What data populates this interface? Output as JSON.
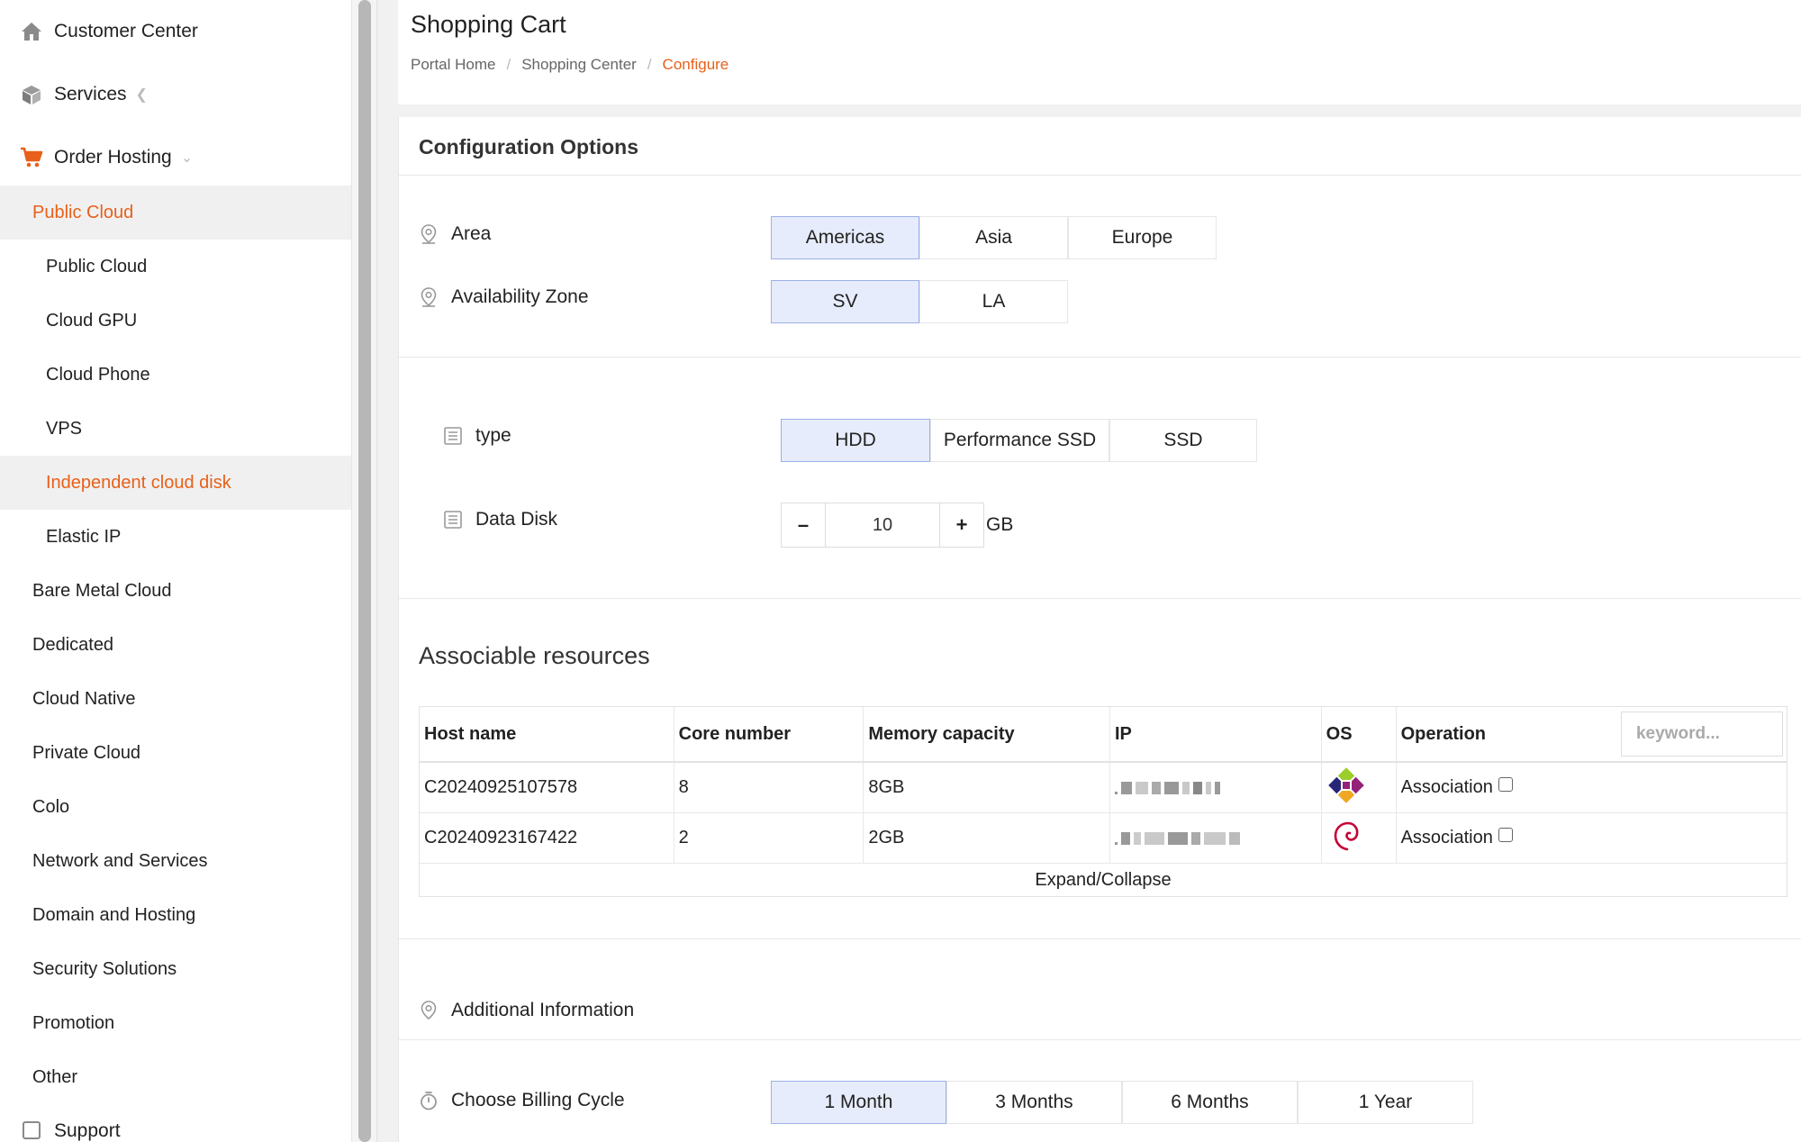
{
  "sidebar": {
    "customer_center": "Customer Center",
    "services": "Services",
    "order_hosting": "Order Hosting",
    "items": [
      {
        "label": "Public Cloud",
        "level": 1,
        "active": true
      },
      {
        "label": "Public Cloud",
        "level": 2,
        "active": false
      },
      {
        "label": "Cloud GPU",
        "level": 2,
        "active": false
      },
      {
        "label": "Cloud Phone",
        "level": 2,
        "active": false
      },
      {
        "label": "VPS",
        "level": 2,
        "active": false
      },
      {
        "label": "Independent cloud disk",
        "level": 2,
        "active": true
      },
      {
        "label": "Elastic IP",
        "level": 2,
        "active": false
      },
      {
        "label": "Bare Metal Cloud",
        "level": 1,
        "active": false
      },
      {
        "label": "Dedicated",
        "level": 1,
        "active": false
      },
      {
        "label": "Cloud Native",
        "level": 1,
        "active": false
      },
      {
        "label": "Private Cloud",
        "level": 1,
        "active": false
      },
      {
        "label": "Colo",
        "level": 1,
        "active": false
      },
      {
        "label": "Network and Services",
        "level": 1,
        "active": false
      },
      {
        "label": "Domain and Hosting",
        "level": 1,
        "active": false
      },
      {
        "label": "Security Solutions",
        "level": 1,
        "active": false
      },
      {
        "label": "Promotion",
        "level": 1,
        "active": false
      },
      {
        "label": "Other",
        "level": 1,
        "active": false
      }
    ],
    "support": "Support"
  },
  "header": {
    "title": "Shopping Cart",
    "breadcrumb": [
      "Portal Home",
      "Shopping Center",
      "Configure"
    ]
  },
  "config": {
    "title": "Configuration Options",
    "area_label": "Area",
    "area_options": [
      "Americas",
      "Asia",
      "Europe"
    ],
    "zone_label": "Availability Zone",
    "zone_options": [
      "SV",
      "LA"
    ],
    "type_label": "type",
    "type_options": [
      "HDD",
      "Performance SSD",
      "SSD"
    ],
    "disk_label": "Data Disk",
    "disk_minus": "–",
    "disk_value": "10",
    "disk_plus": "+",
    "disk_unit": "GB"
  },
  "resources": {
    "title": "Associable resources",
    "headers": [
      "Host name",
      "Core number",
      "Memory capacity",
      "IP",
      "OS",
      "Operation"
    ],
    "keyword_placeholder": "keyword...",
    "rows": [
      {
        "host": "C20240925107578",
        "cores": "8",
        "memory": "8GB",
        "os_icon": "centos-logo-icon",
        "operation": "Association"
      },
      {
        "host": "C20240923167422",
        "cores": "2",
        "memory": "2GB",
        "os_icon": "debian-logo-icon",
        "operation": "Association"
      }
    ],
    "expand": "Expand/Collapse"
  },
  "additional": {
    "label": "Additional Information"
  },
  "billing": {
    "label": "Choose Billing Cycle",
    "options": [
      "1 Month",
      "3 Months",
      "6 Months",
      "1 Year"
    ]
  },
  "colors": {
    "accent": "#e8601a",
    "selected_bg": "#e6ecfb",
    "selected_border": "#9cb0e8"
  }
}
